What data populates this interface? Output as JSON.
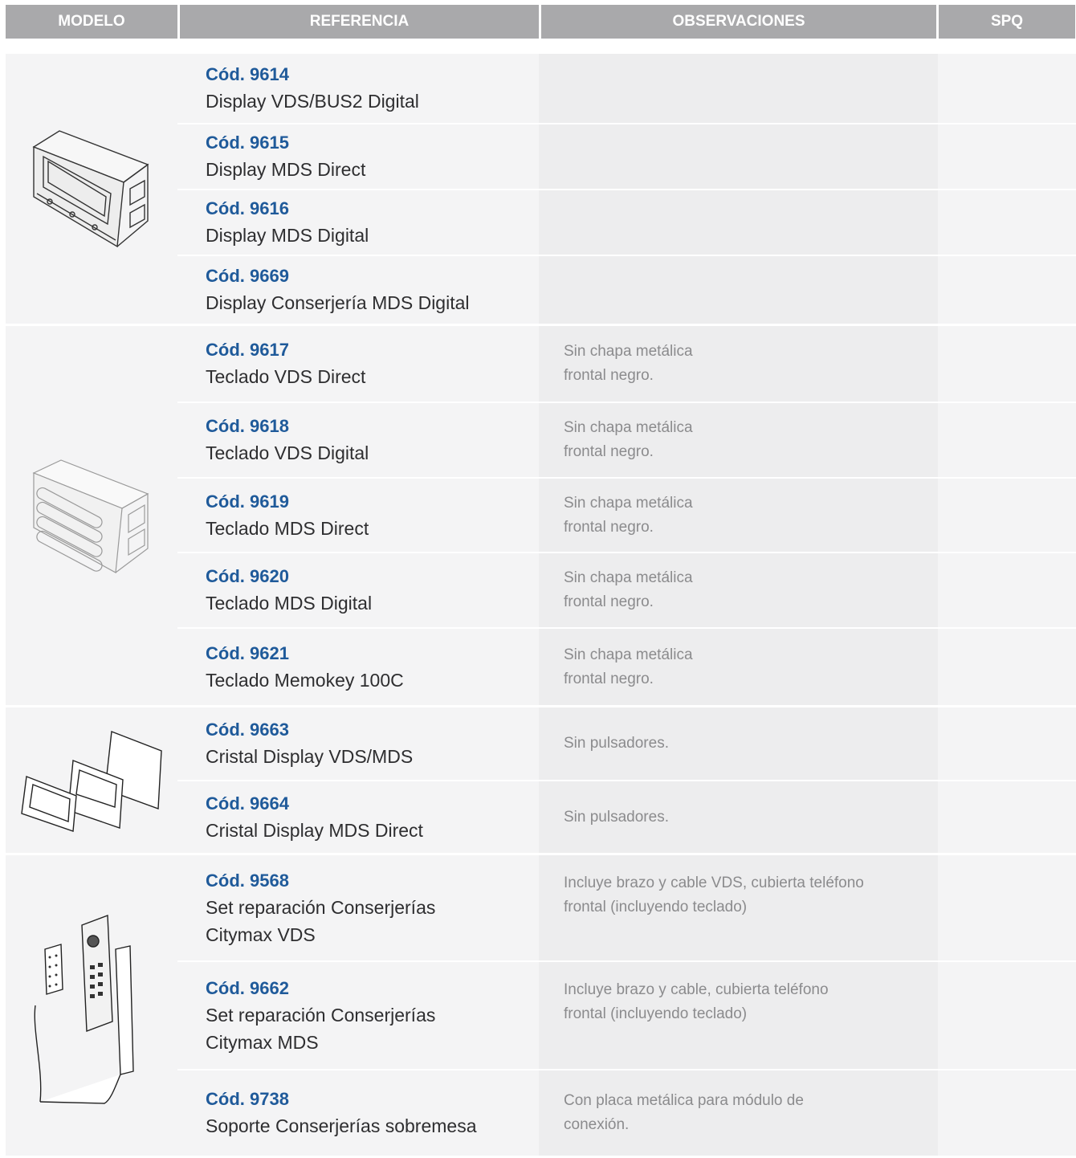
{
  "headers": {
    "modelo": "MODELO",
    "referencia": "REFERENCIA",
    "observaciones": "OBSERVACIONES",
    "spq": "SPQ"
  },
  "groups": [
    {
      "image": "display-module-icon",
      "items": [
        {
          "code": "Cód. 9614",
          "desc": "Display VDS/BUS2 Digital",
          "obs": ""
        },
        {
          "code": "Cód. 9615",
          "desc": "Display MDS Direct",
          "obs": ""
        },
        {
          "code": "Cód. 9616",
          "desc": "Display MDS Digital",
          "obs": ""
        },
        {
          "code": "Cód. 9669",
          "desc": "Display Conserjería MDS Digital",
          "obs": ""
        }
      ]
    },
    {
      "image": "keypad-module-icon",
      "items": [
        {
          "code": "Cód. 9617",
          "desc": "Teclado VDS Direct",
          "obs": "Sin chapa metálica\nfrontal negro."
        },
        {
          "code": "Cód. 9618",
          "desc": "Teclado VDS Digital",
          "obs": "Sin chapa metálica\nfrontal negro."
        },
        {
          "code": "Cód. 9619",
          "desc": "Teclado MDS Direct",
          "obs": "Sin chapa metálica\nfrontal negro."
        },
        {
          "code": "Cód. 9620",
          "desc": "Teclado MDS Digital",
          "obs": "Sin chapa metálica\nfrontal negro."
        },
        {
          "code": "Cód. 9621",
          "desc": "Teclado Memokey 100C",
          "obs": "Sin chapa metálica\nfrontal negro."
        }
      ]
    },
    {
      "image": "glass-panels-icon",
      "items": [
        {
          "code": "Cód. 9663",
          "desc": "Cristal Display VDS/MDS",
          "obs": "Sin pulsadores."
        },
        {
          "code": "Cód. 9664",
          "desc": "Cristal Display MDS Direct",
          "obs": "Sin pulsadores."
        }
      ]
    },
    {
      "image": "concierge-phone-icon",
      "items": [
        {
          "code": "Cód. 9568",
          "desc": "Set reparación Conserjerías\nCitymax VDS",
          "obs": "Incluye brazo y cable VDS, cubierta teléfono\nfrontal (incluyendo teclado)"
        },
        {
          "code": "Cód. 9662",
          "desc": "Set reparación Conserjerías\nCitymax MDS",
          "obs": "Incluye brazo y cable, cubierta teléfono\nfrontal (incluyendo teclado)"
        },
        {
          "code": "Cód. 9738",
          "desc": "Soporte Conserjerías sobremesa",
          "obs": "Con placa metálica para módulo de\nconexión."
        }
      ]
    }
  ]
}
